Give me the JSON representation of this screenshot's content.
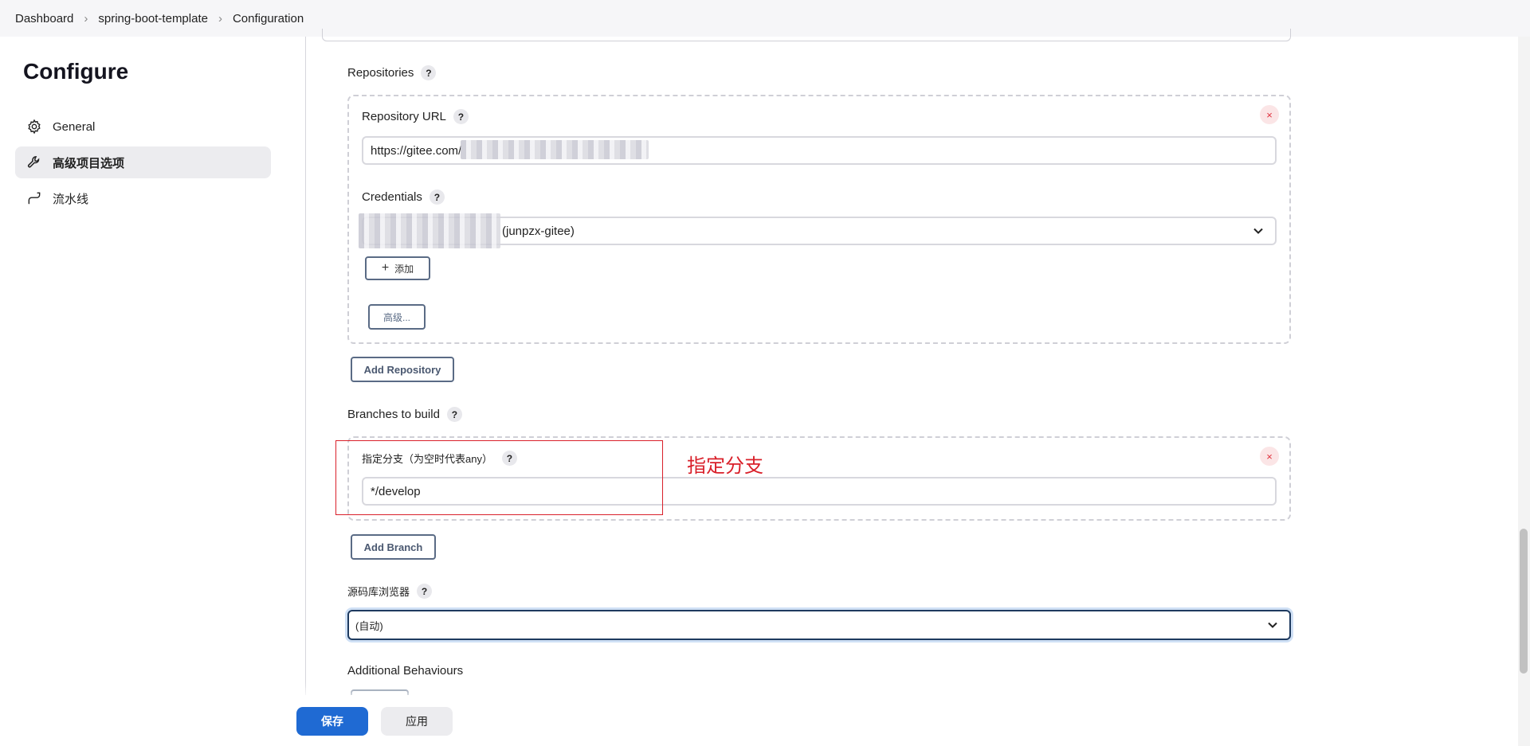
{
  "breadcrumb": {
    "items": [
      "Dashboard",
      "spring-boot-template",
      "Configuration"
    ]
  },
  "sidebar": {
    "title": "Configure",
    "items": [
      {
        "label": "General",
        "icon": "gear-icon"
      },
      {
        "label": "高级项目选项",
        "icon": "wrench-icon",
        "active": true
      },
      {
        "label": "流水线",
        "icon": "pipeline-icon"
      }
    ]
  },
  "repositories": {
    "label": "Repositories",
    "help": "?",
    "url_label": "Repository URL",
    "url_value": "https://gitee.com/",
    "credentials_label": "Credentials",
    "credentials_value": "(junpzx-gitee)",
    "add_button": "添加",
    "advanced_button": "高级...",
    "close_symbol": "×",
    "add_repository_button": "Add Repository"
  },
  "branches": {
    "label": "Branches to build",
    "branch_label": "指定分支（为空时代表any）",
    "branch_value": "*/develop",
    "add_branch_button": "Add Branch",
    "annotation": "指定分支"
  },
  "browser": {
    "label": "源码库浏览器",
    "value": "(自动)"
  },
  "additional": {
    "label": "Additional Behaviours"
  },
  "actions": {
    "save": "保存",
    "apply": "应用"
  },
  "colors": {
    "primary": "#1f6ad3",
    "annotation_red": "#d9202a",
    "close_red": "#e0323e"
  }
}
